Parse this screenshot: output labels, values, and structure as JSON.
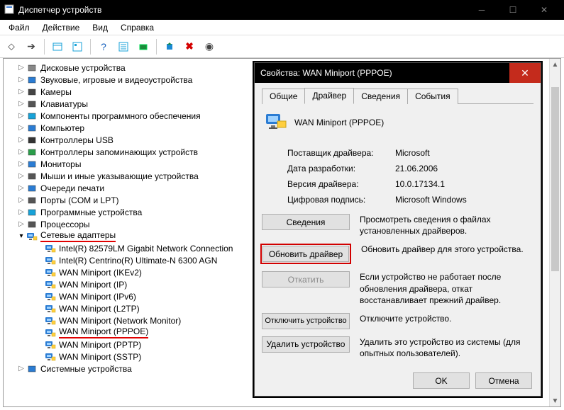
{
  "window": {
    "title": "Диспетчер устройств"
  },
  "menu": [
    "Файл",
    "Действие",
    "Вид",
    "Справка"
  ],
  "tree": {
    "items": [
      {
        "label": "Дисковые устройства",
        "icon": "disk",
        "level": 1,
        "arrow": "closed"
      },
      {
        "label": "Звуковые, игровые и видеоустройства",
        "icon": "sound",
        "level": 1,
        "arrow": "closed"
      },
      {
        "label": "Камеры",
        "icon": "cam",
        "level": 1,
        "arrow": "closed"
      },
      {
        "label": "Клавиатуры",
        "icon": "kbd",
        "level": 1,
        "arrow": "closed"
      },
      {
        "label": "Компоненты программного обеспечения",
        "icon": "sw",
        "level": 1,
        "arrow": "closed"
      },
      {
        "label": "Компьютер",
        "icon": "pc",
        "level": 1,
        "arrow": "closed"
      },
      {
        "label": "Контроллеры USB",
        "icon": "usb",
        "level": 1,
        "arrow": "closed"
      },
      {
        "label": "Контроллеры запоминающих устройств",
        "icon": "stor",
        "level": 1,
        "arrow": "closed"
      },
      {
        "label": "Мониторы",
        "icon": "mon",
        "level": 1,
        "arrow": "closed"
      },
      {
        "label": "Мыши и иные указывающие устройства",
        "icon": "mouse",
        "level": 1,
        "arrow": "closed"
      },
      {
        "label": "Очереди печати",
        "icon": "print",
        "level": 1,
        "arrow": "closed"
      },
      {
        "label": "Порты (COM и LPT)",
        "icon": "port",
        "level": 1,
        "arrow": "closed"
      },
      {
        "label": "Программные устройства",
        "icon": "sw2",
        "level": 1,
        "arrow": "closed"
      },
      {
        "label": "Процессоры",
        "icon": "cpu",
        "level": 1,
        "arrow": "closed"
      },
      {
        "label": "Сетевые адаптеры",
        "icon": "net",
        "level": 1,
        "arrow": "open",
        "underline": true
      },
      {
        "label": "Intel(R) 82579LM Gigabit Network Connection",
        "icon": "netc",
        "level": 2
      },
      {
        "label": "Intel(R) Centrino(R) Ultimate-N 6300 AGN",
        "icon": "netc",
        "level": 2
      },
      {
        "label": "WAN Miniport (IKEv2)",
        "icon": "netc",
        "level": 2
      },
      {
        "label": "WAN Miniport (IP)",
        "icon": "netc",
        "level": 2
      },
      {
        "label": "WAN Miniport (IPv6)",
        "icon": "netc",
        "level": 2
      },
      {
        "label": "WAN Miniport (L2TP)",
        "icon": "netc",
        "level": 2
      },
      {
        "label": "WAN Miniport (Network Monitor)",
        "icon": "netc",
        "level": 2
      },
      {
        "label": "WAN Miniport (PPPOE)",
        "icon": "netc",
        "level": 2,
        "underline": true
      },
      {
        "label": "WAN Miniport (PPTP)",
        "icon": "netc",
        "level": 2
      },
      {
        "label": "WAN Miniport (SSTP)",
        "icon": "netc",
        "level": 2
      },
      {
        "label": "Системные устройства",
        "icon": "sys",
        "level": 1,
        "arrow": "closed"
      }
    ]
  },
  "dialog": {
    "title": "Свойства: WAN Miniport (PPPOE)",
    "tabs": [
      "Общие",
      "Драйвер",
      "Сведения",
      "События"
    ],
    "active_tab": 1,
    "device_name": "WAN Miniport (PPPOE)",
    "info": {
      "provider_label": "Поставщик драйвера:",
      "provider_value": "Microsoft",
      "date_label": "Дата разработки:",
      "date_value": "21.06.2006",
      "version_label": "Версия драйвера:",
      "version_value": "10.0.17134.1",
      "signature_label": "Цифровая подпись:",
      "signature_value": "Microsoft Windows"
    },
    "actions": {
      "details_label": "Сведения",
      "details_desc": "Просмотреть сведения о файлах установленных драйверов.",
      "update_label": "Обновить драйвер",
      "update_desc": "Обновить драйвер для этого устройства.",
      "rollback_label": "Откатить",
      "rollback_desc": "Если устройство не работает после обновления драйвера, откат восстанавливает прежний драйвер.",
      "disable_label": "Отключить устройство",
      "disable_desc": "Отключите устройство.",
      "uninstall_label": "Удалить устройство",
      "uninstall_desc": "Удалить это устройство из системы (для опытных пользователей)."
    },
    "ok": "OK",
    "cancel": "Отмена"
  }
}
